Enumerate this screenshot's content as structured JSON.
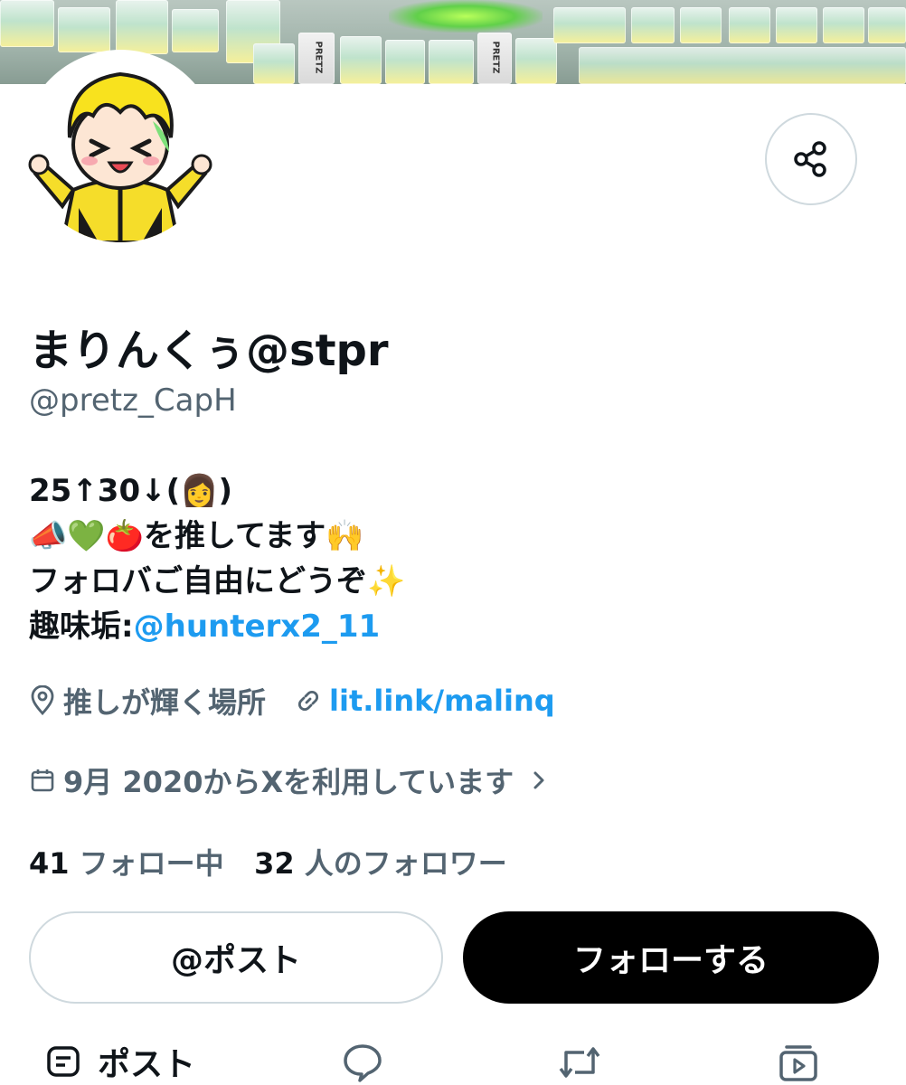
{
  "profile": {
    "display_name": "まりんくぅ@stpr",
    "handle": "@pretz_CapH",
    "bio": {
      "line1": "25↑30↓(👩)",
      "line2": "📣💚🍅を推してます🙌",
      "line3": "フォロバご自由にどうぞ✨",
      "line4_prefix": "趣味垢:",
      "line4_mention": "@hunterx2_11"
    },
    "location": "推しが輝く場所",
    "website": "lit.link/malinq",
    "joined": "9月 2020からXを利用しています",
    "following_count": "41",
    "following_label": "フォロー中",
    "followers_count": "32",
    "followers_label": "人のフォロワー"
  },
  "actions": {
    "post_button": "@ポスト",
    "follow_button": "フォローする"
  },
  "tabs": {
    "posts_label": "ポスト"
  },
  "banner_text": {
    "pretz": "PRETZ"
  },
  "icons": [
    "share-icon",
    "location-pin-icon",
    "link-icon",
    "calendar-icon",
    "chevron-right-icon",
    "post-tab-icon",
    "reply-icon",
    "repost-icon",
    "media-icon"
  ],
  "colors": {
    "accent": "#1d9bf0",
    "text": "#0f1419",
    "secondary_text": "#536471",
    "border": "#cfd9de",
    "follow_button_bg": "#000000"
  }
}
